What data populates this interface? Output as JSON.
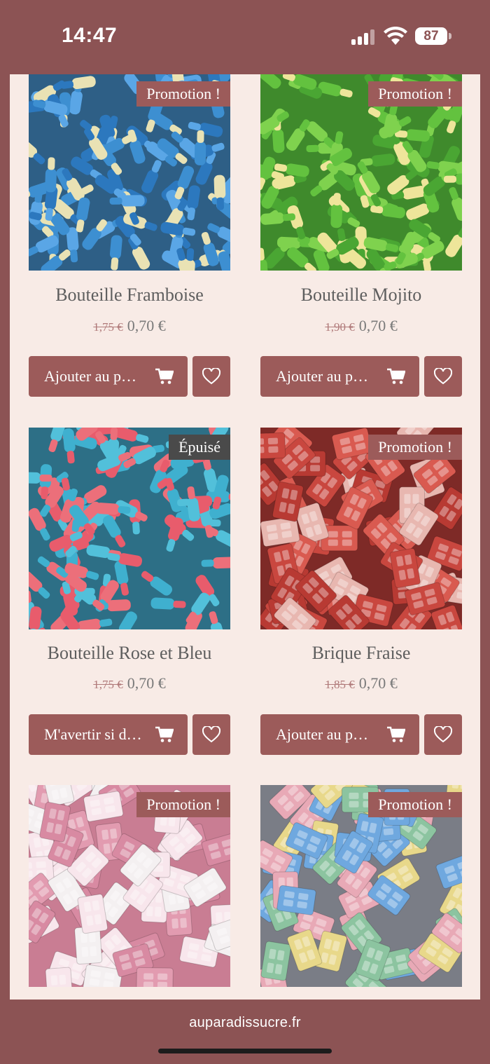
{
  "status_bar": {
    "time": "14:47",
    "battery": "87"
  },
  "products": [
    {
      "title": "Bouteille Framboise",
      "old_price": "1,75 €",
      "price": "0,70 €",
      "badge": "Promotion !",
      "button": "Ajouter au p…",
      "palette": "blue-bottles"
    },
    {
      "title": "Bouteille Mojito",
      "old_price": "1,90 €",
      "price": "0,70 €",
      "badge": "Promotion !",
      "button": "Ajouter au p…",
      "palette": "green-bottles"
    },
    {
      "title": "Bouteille Rose et Bleu",
      "old_price": "1,75 €",
      "price": "0,70 €",
      "badge": "Épuisé",
      "button": "M'avertir si d…",
      "palette": "pink-blue-bottles"
    },
    {
      "title": "Brique Fraise",
      "old_price": "1,85 €",
      "price": "0,70 €",
      "badge": "Promotion !",
      "button": "Ajouter au p…",
      "palette": "red-bricks"
    },
    {
      "title": "",
      "old_price": "",
      "price": "",
      "badge": "Promotion !",
      "button": "",
      "palette": "pink-white-bricks"
    },
    {
      "title": "",
      "old_price": "",
      "price": "",
      "badge": "Promotion !",
      "button": "",
      "palette": "multicolor-bricks"
    }
  ],
  "url_bar": {
    "url": "auparadissucre.fr"
  },
  "colors": {
    "frame": "#8c5354",
    "page_bg": "#f8ebe6",
    "button": "#9c5b5a",
    "sold_out_badge": "#4a4a4a"
  }
}
